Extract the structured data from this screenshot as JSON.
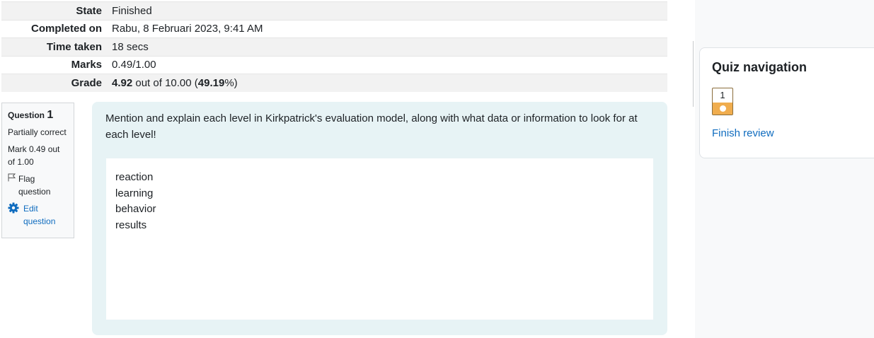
{
  "summary": {
    "rows": [
      {
        "label": "State",
        "value": "Finished"
      },
      {
        "label": "Completed on",
        "value": "Rabu, 8 Februari 2023, 9:41 AM"
      },
      {
        "label": "Time taken",
        "value": "18 secs"
      },
      {
        "label": "Marks",
        "value": "0.49/1.00"
      }
    ],
    "grade": {
      "label": "Grade",
      "score": "4.92",
      "mid": " out of 10.00 (",
      "percent": "49.19",
      "end": "%)"
    }
  },
  "question": {
    "prefix": "Question",
    "number": "1",
    "status": "Partially correct",
    "mark": "Mark 0.49 out of 1.00",
    "flag_label": "Flag question",
    "edit_label": "Edit question",
    "text": "Mention and explain each level in Kirkpatrick's evaluation model, along with what data or information to look for at each level!",
    "answer_lines": [
      "reaction",
      "learning",
      "behavior",
      "results"
    ]
  },
  "nav": {
    "title": "Quiz navigation",
    "button_number": "1",
    "finish_label": "Finish review"
  },
  "icons": {
    "flag": "flag-icon",
    "edit": "gear-icon"
  },
  "colors": {
    "link": "#0f6cbf",
    "partial": "#f0ad4e",
    "content_bg": "#e7f3f5"
  }
}
